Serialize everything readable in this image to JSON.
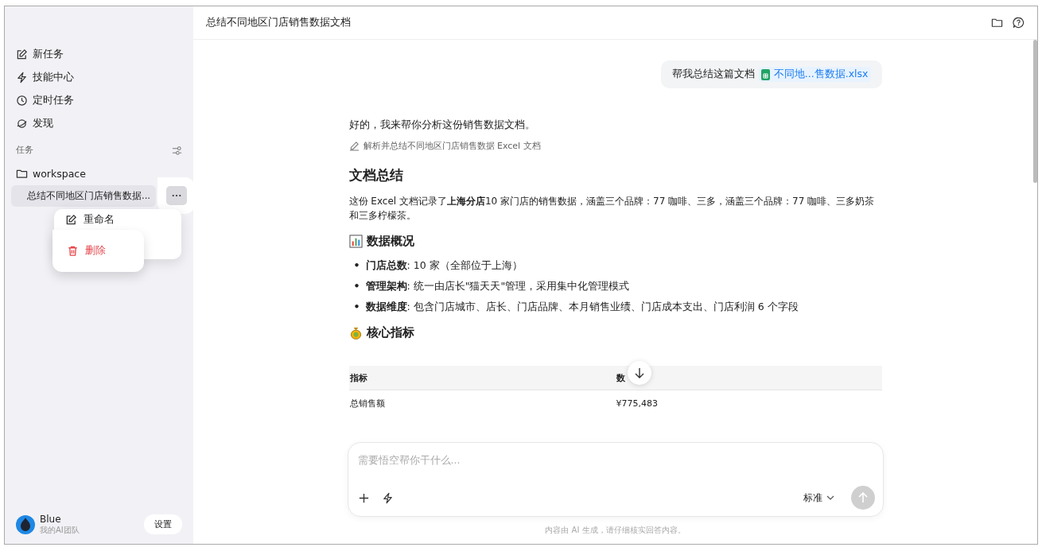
{
  "sidebar": {
    "nav": [
      {
        "label": "新任务"
      },
      {
        "label": "技能中心"
      },
      {
        "label": "定时任务"
      },
      {
        "label": "发现"
      }
    ],
    "section_label": "任务",
    "workspace": "workspace",
    "tasks": [
      {
        "title": "总结不同地区门店销售数据...",
        "selected": true
      }
    ],
    "context_menu": [
      {
        "label": "重命名",
        "kind": "normal",
        "selected": false
      },
      {
        "label": "删除",
        "kind": "danger",
        "selected": true
      }
    ],
    "user": {
      "name": "Blue",
      "subtitle": "我的AI团队"
    },
    "settings_button": "设置"
  },
  "header": {
    "title": "总结不同地区门店销售数据文档"
  },
  "chat": {
    "user_message": {
      "text": "帮我总结这篇文档",
      "attachment": "不同地...售数据.xlsx"
    },
    "reply": {
      "intro": "好的，我来帮你分析这份销售数据文档。",
      "step": "解析并总结不同地区门店销售数据 Excel 文档",
      "title": "文档总结",
      "paragraph": "这份 Excel 文档记录了**上海分店**10 家门店的销售数据，涵盖三个品牌：77 咖啡、三多，涵盖三个品牌：77 咖啡、三多奶茶和三多柠檬茶。",
      "overview_title": "数据概况",
      "bullets": [
        {
          "marker": "•",
          "text": "**门店总数**: 10 家（全部位于上海）"
        },
        {
          "marker": "•",
          "text": "**管理架构**: 统一由店长\"猫天天\"管理，采用集中化管理模式"
        },
        {
          "marker": "•",
          "text": "**数据维度**: 包含门店城市、店长、门店品牌、本月销售业绩、门店成本支出、门店利润 6 个字段"
        }
      ],
      "metrics_title": "核心指标",
      "table": {
        "columns": [
          "指标",
          "数"
        ],
        "rows": [
          [
            "总销售额",
            "¥775,483"
          ]
        ]
      }
    }
  },
  "composer": {
    "placeholder": "需要悟空帮你干什么...",
    "mode": "标准",
    "send_disabled": true
  },
  "footer": "内容由 AI 生成，请仔细核实回答内容。"
}
